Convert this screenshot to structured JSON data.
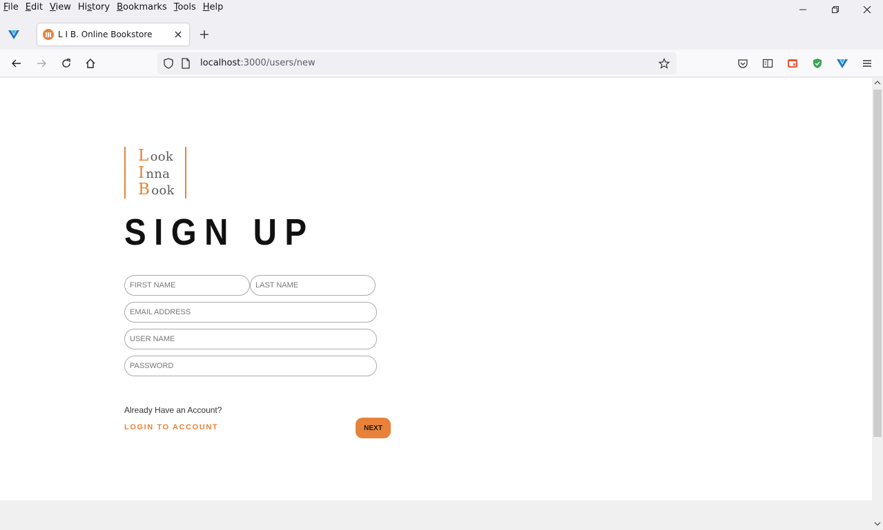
{
  "menu": {
    "items": [
      {
        "key": "F",
        "rest": "ile"
      },
      {
        "key": "E",
        "rest": "dit"
      },
      {
        "key": "V",
        "rest": "iew"
      },
      {
        "pre": "Hi",
        "key": "s",
        "rest": "tory"
      },
      {
        "key": "B",
        "rest": "ookmarks"
      },
      {
        "key": "T",
        "rest": "ools"
      },
      {
        "key": "H",
        "rest": "elp"
      }
    ]
  },
  "tab": {
    "title": "L I B. Online Bookstore"
  },
  "address": {
    "host": "localhost",
    "path": ":3000/users/new"
  },
  "logo": {
    "lines": [
      {
        "cap": "L",
        "rest": "ook"
      },
      {
        "cap": "I",
        "rest": "nna"
      },
      {
        "cap": "B",
        "rest": "ook"
      }
    ]
  },
  "form": {
    "title": "SIGN UP",
    "first_name_placeholder": "FIRST NAME",
    "last_name_placeholder": "LAST NAME",
    "email_placeholder": "EMAIL ADDRESS",
    "username_placeholder": "USER NAME",
    "password_placeholder": "PASSWORD",
    "already_text": "Already Have an Account?",
    "login_link": "LOGIN TO ACCOUNT",
    "next_button": "NEXT"
  },
  "colors": {
    "accent": "#e8823a"
  },
  "icons": {
    "toolbar": [
      "pocket-icon",
      "reader-view-icon",
      "extension-icon",
      "shield-extension-icon",
      "vivaldi-extension-icon",
      "hamburger-menu-icon"
    ]
  }
}
